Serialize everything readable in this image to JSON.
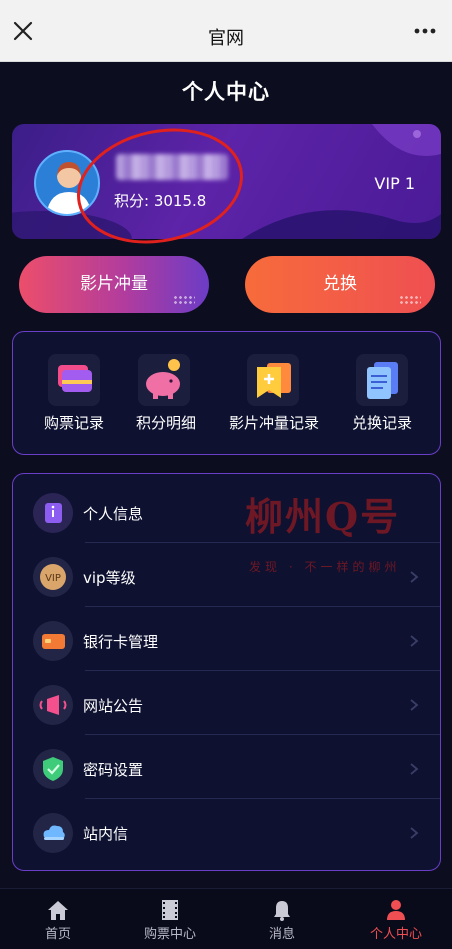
{
  "window": {
    "title": "官网"
  },
  "header": {
    "title": "个人中心"
  },
  "profile": {
    "points_label": "积分: 3015.8",
    "vip_level": "VIP 1"
  },
  "actions": {
    "movie_boost_label": "影片冲量",
    "exchange_label": "兑换"
  },
  "quick_links": [
    {
      "label": "购票记录",
      "icon": "ticket-cards-icon"
    },
    {
      "label": "积分明细",
      "icon": "piggy-bank-icon"
    },
    {
      "label": "影片冲量记录",
      "icon": "plus-bookmark-icon"
    },
    {
      "label": "兑换记录",
      "icon": "document-icon"
    }
  ],
  "menu": [
    {
      "label": "个人信息",
      "icon": "personal-info-icon"
    },
    {
      "label": "vip等级",
      "icon": "vip-badge-icon"
    },
    {
      "label": "银行卡管理",
      "icon": "bank-card-icon"
    },
    {
      "label": "网站公告",
      "icon": "announcement-icon"
    },
    {
      "label": "密码设置",
      "icon": "password-shield-icon"
    },
    {
      "label": "站内信",
      "icon": "message-cloud-icon"
    }
  ],
  "watermark": {
    "brand": "柳州Q号",
    "slogan": "发现 · 不一样的柳州"
  },
  "tabbar": [
    {
      "label": "首页",
      "icon": "home-icon"
    },
    {
      "label": "购票中心",
      "icon": "film-icon"
    },
    {
      "label": "消息",
      "icon": "bell-icon"
    },
    {
      "label": "个人中心",
      "icon": "user-icon",
      "active": true
    }
  ],
  "colors": {
    "accent": "#ef4f52",
    "panel_border": "#6a3fc8",
    "card_bg": "#4a1b97",
    "background": "#0c0d1f"
  }
}
